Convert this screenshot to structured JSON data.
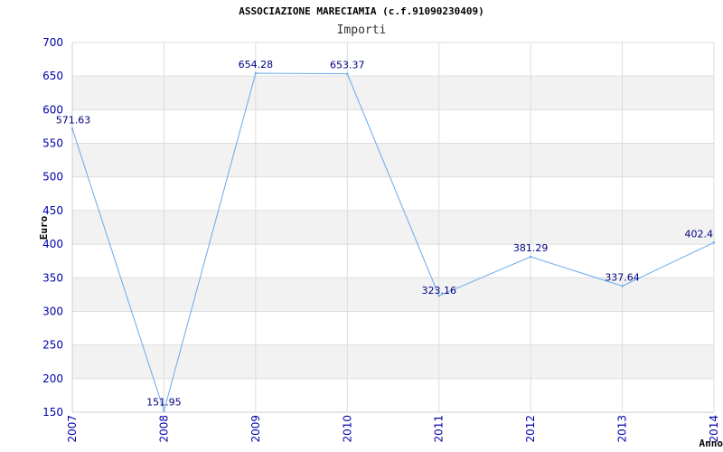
{
  "chart_data": {
    "type": "line",
    "title": "ASSOCIAZIONE MARECIAMIA (c.f.91090230409)",
    "subtitle": "Importi",
    "xlabel": "Anno",
    "ylabel": "Euro",
    "categories": [
      "2007",
      "2008",
      "2009",
      "2010",
      "2011",
      "2012",
      "2013",
      "2014"
    ],
    "series": [
      {
        "values": [
          571.63,
          151.95,
          654.28,
          653.37,
          323.16,
          381.29,
          337.64,
          402.4
        ],
        "labels": [
          "571.63",
          "151.95",
          "654.28",
          "653.37",
          "323.16",
          "381.29",
          "337.64",
          "402.4"
        ]
      }
    ],
    "ylim": [
      150,
      700
    ],
    "yticks": [
      "150",
      "200",
      "250",
      "300",
      "350",
      "400",
      "450",
      "500",
      "550",
      "600",
      "650",
      "700"
    ],
    "grid": "horizontal alternating bands",
    "legend": "none",
    "colors": {
      "line": "#66aaee",
      "band": "#f2f2f2",
      "gridline": "#dddddd",
      "tick_label": "#0000aa",
      "data_label": "#000080",
      "title": "#000000"
    }
  }
}
